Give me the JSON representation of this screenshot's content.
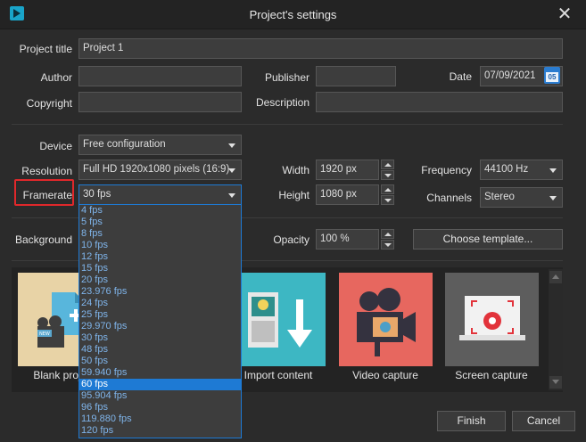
{
  "window": {
    "title": "Project's settings"
  },
  "labels": {
    "project_title": "Project title",
    "author": "Author",
    "copyright": "Copyright",
    "publisher": "Publisher",
    "description": "Description",
    "date": "Date",
    "device": "Device",
    "resolution": "Resolution",
    "framerate": "Framerate",
    "width": "Width",
    "height": "Height",
    "frequency": "Frequency",
    "channels": "Channels",
    "background": "Background",
    "opacity": "Opacity"
  },
  "values": {
    "project_title": "Project 1",
    "author": "",
    "copyright": "",
    "publisher": "",
    "description": "",
    "date": "07/09/2021",
    "calendar_day": "05",
    "device": "Free configuration",
    "resolution": "Full HD 1920x1080 pixels (16:9)",
    "framerate": "30 fps",
    "width": "1920 px",
    "height": "1080 px",
    "frequency": "44100 Hz",
    "channels": "Stereo",
    "opacity": "100 %"
  },
  "buttons": {
    "choose_template": "Choose template...",
    "finish": "Finish",
    "cancel": "Cancel"
  },
  "templates": [
    {
      "label": "Blank project"
    },
    {
      "label": "Import content"
    },
    {
      "label": "Video capture"
    },
    {
      "label": "Screen capture"
    }
  ],
  "framerate_options": [
    "4 fps",
    "5 fps",
    "8 fps",
    "10 fps",
    "12 fps",
    "15 fps",
    "20 fps",
    "23.976 fps",
    "24 fps",
    "25 fps",
    "29.970 fps",
    "30 fps",
    "48 fps",
    "50 fps",
    "59.940 fps",
    "60 fps",
    "95.904 fps",
    "96 fps",
    "119.880 fps",
    "120 fps"
  ],
  "framerate_highlighted": "60 fps",
  "colors": {
    "accent": "#1e7ad4",
    "highlight_box": "#e0282b"
  }
}
